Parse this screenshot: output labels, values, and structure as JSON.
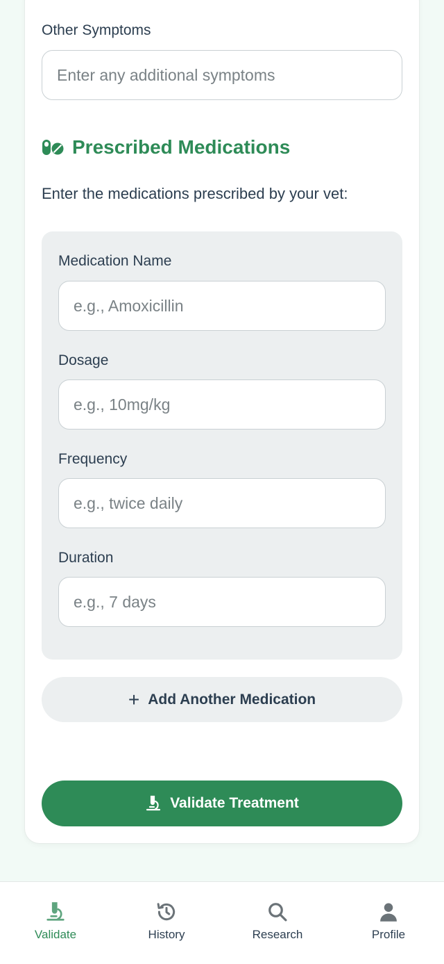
{
  "symptoms": {
    "other_label": "Other Symptoms",
    "other_placeholder": "Enter any additional symptoms"
  },
  "medications": {
    "section_title": "Prescribed Medications",
    "section_icon": "pills-icon",
    "intro": "Enter the medications prescribed by your vet:",
    "name_label": "Medication Name",
    "name_placeholder": "e.g., Amoxicillin",
    "dosage_label": "Dosage",
    "dosage_placeholder": "e.g., 10mg/kg",
    "frequency_label": "Frequency",
    "frequency_placeholder": "e.g., twice daily",
    "duration_label": "Duration",
    "duration_placeholder": "e.g., 7 days",
    "add_button": "Add Another Medication",
    "add_icon": "plus-icon"
  },
  "validate_button": {
    "label": "Validate Treatment",
    "icon": "microscope-icon"
  },
  "nav": {
    "items": [
      {
        "label": "Validate",
        "icon": "microscope-icon",
        "active": true
      },
      {
        "label": "History",
        "icon": "history-icon",
        "active": false
      },
      {
        "label": "Research",
        "icon": "search-icon",
        "active": false
      },
      {
        "label": "Profile",
        "icon": "user-icon",
        "active": false
      }
    ]
  },
  "colors": {
    "primary": "#2e8b57",
    "text": "#2c3e50",
    "muted_icon": "#6b7378",
    "panel": "#eceff0",
    "background": "#f2faf6"
  }
}
